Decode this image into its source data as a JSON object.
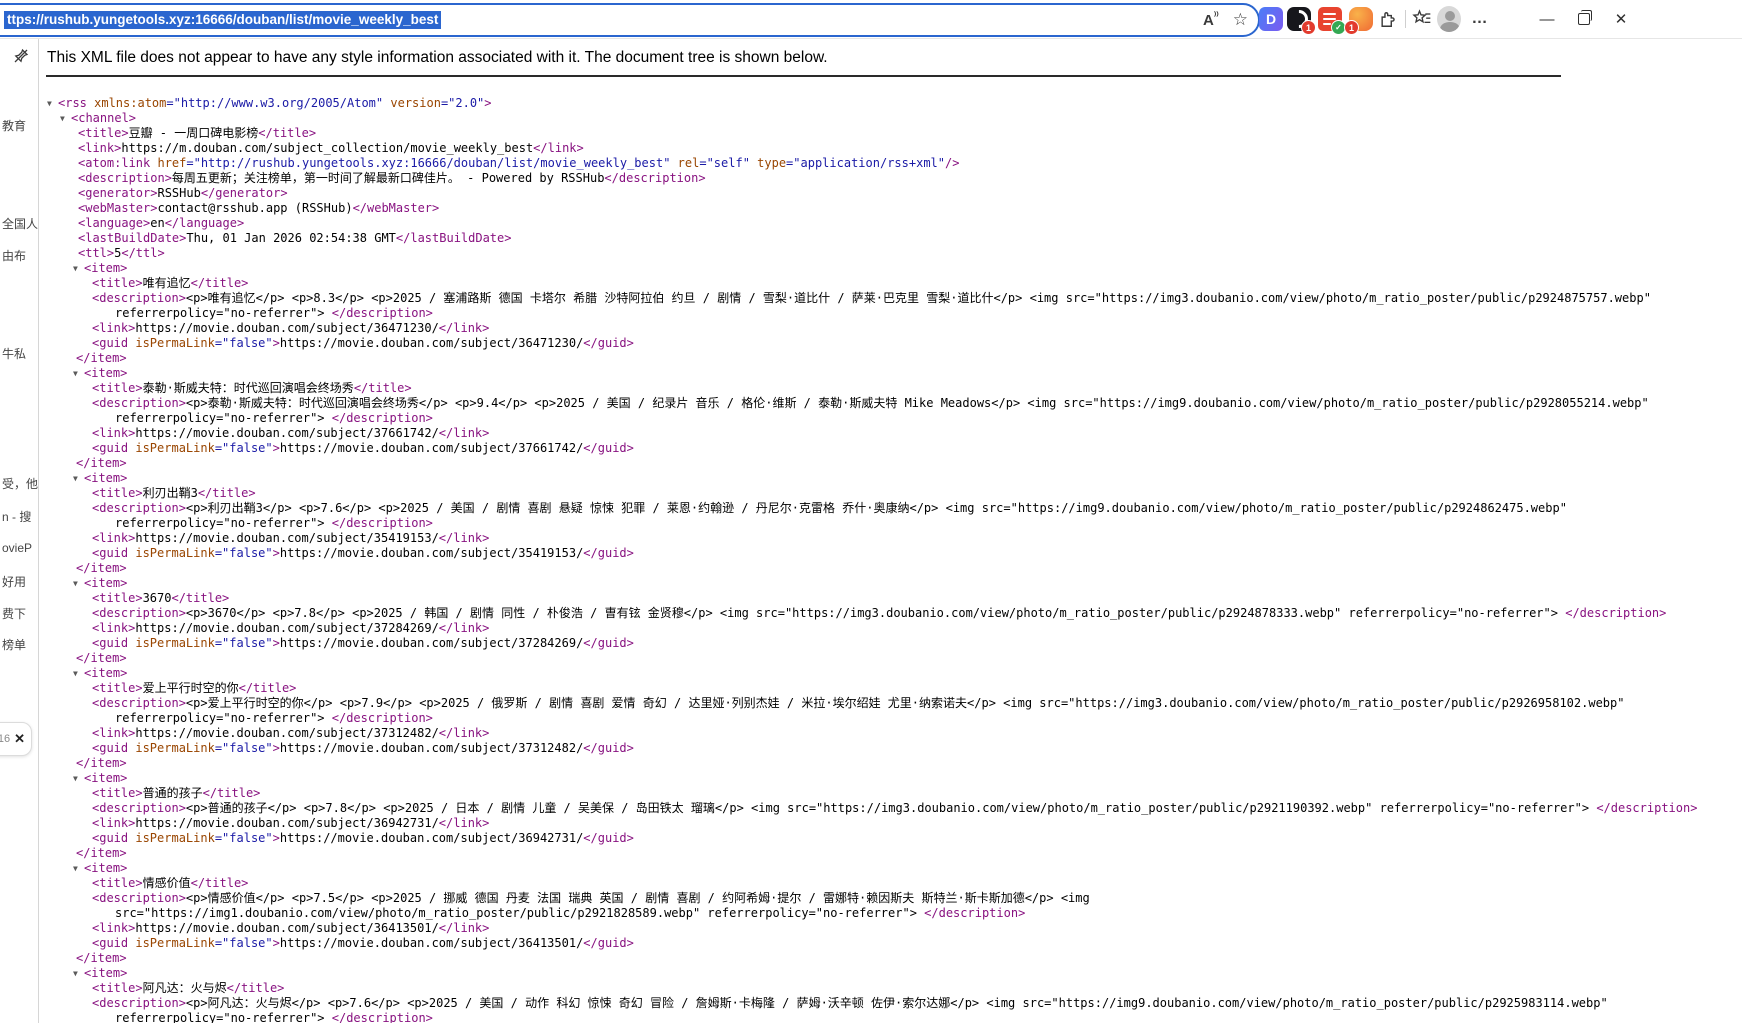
{
  "browser": {
    "url": "ttps://rushub.yungetools.xyz:16666/douban/list/movie_weekly_best",
    "read_aloud_label": "A",
    "toolbar_icons": [
      "read-aloud",
      "favorite-star",
      "extension-d",
      "extension-dark-badge",
      "extension-doc-check",
      "extension-orange-badge",
      "extensions-puzzle",
      "collections-star",
      "profile-avatar",
      "more-menu"
    ],
    "extension_d_label": "D",
    "badge_dark": "1",
    "badge_orange": "1",
    "more_label": "…",
    "minimize_label": "—",
    "close_label": "✕"
  },
  "sidebar": {
    "fragments": [
      "教育",
      "全国人",
      "由布",
      "牛私",
      "受，他",
      "n - 搜",
      "ovieP",
      "好用",
      "费下",
      "榜单"
    ],
    "tab_count": "16",
    "tab_close_label": "✕"
  },
  "viewer": {
    "notice": "This XML file does not appear to have any style information associated with it. The document tree is shown below."
  },
  "xml": {
    "rss_attrs": [
      [
        "xmlns:atom",
        "http://www.w3.org/2005/Atom"
      ],
      [
        "version",
        "2.0"
      ]
    ],
    "channel": [
      [
        "title",
        "豆瓣 - 一周口碑电影榜"
      ],
      [
        "link",
        "https://m.douban.com/subject_collection/movie_weekly_best"
      ],
      {
        "tag": "atom:link",
        "self": true,
        "attrs": [
          [
            "href",
            "http://rushub.yungetools.xyz:16666/douban/list/movie_weekly_best"
          ],
          [
            "rel",
            "self"
          ],
          [
            "type",
            "application/rss+xml"
          ]
        ]
      },
      [
        "description",
        "每周五更新；关注榜单，第一时间了解最新口碑佳片。 - Powered by RSSHub"
      ],
      [
        "generator",
        "RSSHub"
      ],
      [
        "webMaster",
        "contact@rsshub.app (RSSHub)"
      ],
      [
        "language",
        "en"
      ],
      [
        "lastBuildDate",
        "Thu, 01 Jan 2026 02:54:38 GMT"
      ],
      [
        "ttl",
        "5"
      ]
    ],
    "items": [
      {
        "title": "唯有追忆",
        "desc1": "<p>唯有追忆</p> <p>8.3</p> <p>2025 / 塞浦路斯 德国 卡塔尔 希腊 沙特阿拉伯 约旦 / 剧情 / 雪梨·道比什 / 萨莱·巴克里 雪梨·道比什</p> <img src=\"https://img3.doubanio.com/view/photo/m_ratio_poster/public/p2924875757.webp\"",
        "desc2": "referrerpolicy=\"no-referrer\"> ",
        "link": "https://movie.douban.com/subject/36471230/"
      },
      {
        "title": "泰勒·斯威夫特：时代巡回演唱会终场秀",
        "desc1": "<p>泰勒·斯威夫特：时代巡回演唱会终场秀</p> <p>9.4</p> <p>2025 / 美国 / 纪录片 音乐 / 格伦·维斯 / 泰勒·斯威夫特 Mike Meadows</p> <img src=\"https://img9.doubanio.com/view/photo/m_ratio_poster/public/p2928055214.webp\"",
        "desc2": "referrerpolicy=\"no-referrer\"> ",
        "link": "https://movie.douban.com/subject/37661742/"
      },
      {
        "title": "利刃出鞘3",
        "desc1": "<p>利刃出鞘3</p> <p>7.6</p> <p>2025 / 美国 / 剧情 喜剧 悬疑 惊悚 犯罪 / 莱恩·约翰逊 / 丹尼尔·克雷格 乔什·奥康纳</p> <img src=\"https://img9.doubanio.com/view/photo/m_ratio_poster/public/p2924862475.webp\"",
        "desc2": "referrerpolicy=\"no-referrer\"> ",
        "link": "https://movie.douban.com/subject/35419153/"
      },
      {
        "title": "3670",
        "desc1": "<p>3670</p> <p>7.8</p> <p>2025 / 韩国 / 剧情 同性 / 朴俊浩 / 曺有铉 金贤穆</p> <img src=\"https://img3.doubanio.com/view/photo/m_ratio_poster/public/p2924878333.webp\" referrerpolicy=\"no-referrer\"> ",
        "desc2": null,
        "link": "https://movie.douban.com/subject/37284269/"
      },
      {
        "title": "爱上平行时空的你",
        "desc1": "<p>爱上平行时空的你</p> <p>7.9</p> <p>2025 / 俄罗斯 / 剧情 喜剧 爱情 奇幻 / 达里娅·列别杰娃 / 米拉·埃尔绍娃 尤里·纳索诺夫</p> <img src=\"https://img3.doubanio.com/view/photo/m_ratio_poster/public/p2926958102.webp\"",
        "desc2": "referrerpolicy=\"no-referrer\"> ",
        "link": "https://movie.douban.com/subject/37312482/"
      },
      {
        "title": "普通的孩子",
        "desc1": "<p>普通的孩子</p> <p>7.8</p> <p>2025 / 日本 / 剧情 儿童 / 吴美保 / 岛田铁太 瑠璃</p> <img src=\"https://img3.doubanio.com/view/photo/m_ratio_poster/public/p2921190392.webp\" referrerpolicy=\"no-referrer\"> ",
        "desc2": null,
        "link": "https://movie.douban.com/subject/36942731/"
      },
      {
        "title": "情感价值",
        "desc1": "<p>情感价值</p> <p>7.5</p> <p>2025 / 挪威 德国 丹麦 法国 瑞典 英国 / 剧情 喜剧 / 约阿希姆·提尔 / 雷娜特·赖因斯夫 斯特兰·斯卡斯加德</p> <img",
        "desc2": "src=\"https://img1.doubanio.com/view/photo/m_ratio_poster/public/p2921828589.webp\" referrerpolicy=\"no-referrer\"> ",
        "link": "https://movie.douban.com/subject/36413501/"
      },
      {
        "title": "阿凡达：火与烬",
        "desc1": "<p>阿凡达：火与烬</p> <p>7.6</p> <p>2025 / 美国 / 动作 科幻 惊悚 奇幻 冒险 / 詹姆斯·卡梅隆 / 萨姆·沃辛顿 佐伊·索尔达娜</p> <img src=\"https://img9.doubanio.com/view/photo/m_ratio_poster/public/p2925983114.webp\"",
        "desc2": "referrerpolicy=\"no-referrer\"> ",
        "link": null
      }
    ]
  }
}
